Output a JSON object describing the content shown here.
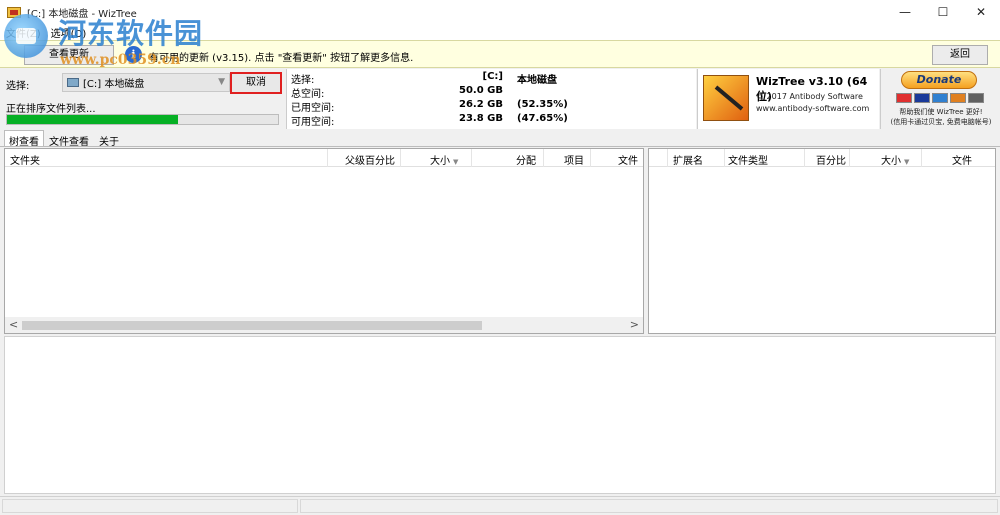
{
  "window": {
    "title": "[C:] 本地磁盘  - WizTree",
    "minimize": "—",
    "maximize": "☐",
    "close": "✕"
  },
  "menu": [
    "文件(Z)",
    "选项(O)"
  ],
  "watermark": {
    "text": "河东软件园",
    "url": "www.pc0359.cn"
  },
  "notification": {
    "update_button": "查看更新",
    "message": "有可用的更新 (v3.15). 点击 \"查看更新\" 按钮了解更多信息.",
    "return_button": "返回"
  },
  "scan": {
    "select_label": "选择:",
    "drive": "[C:] 本地磁盘",
    "cancel_label": "取消",
    "status": "正在排序文件列表...",
    "progress": 0.63
  },
  "drive_stats": {
    "rows": [
      {
        "label": "选择:",
        "value": "[C:]",
        "extra": "本地磁盘"
      },
      {
        "label": "总空间:",
        "value": "50.0 GB",
        "extra": ""
      },
      {
        "label": "已用空间:",
        "value": "26.2 GB",
        "extra": "(52.35%)"
      },
      {
        "label": "可用空间:",
        "value": "23.8 GB",
        "extra": "(47.65%)"
      }
    ]
  },
  "about": {
    "title": "WizTree v3.10 (64 位)",
    "copyright": "© 2017 Antibody Software",
    "website": "www.antibody-software.com"
  },
  "donate": {
    "button": "Donate",
    "line1": "帮助我们使 WizTree 更好!",
    "line2": "(信用卡通过贝宝, 免费电脑帐号)",
    "card_colors": [
      "#e03030",
      "#1a3a9a",
      "#3080d0",
      "#e08020",
      "#606060"
    ]
  },
  "tabs": [
    "树查看",
    "文件查看",
    "关于"
  ],
  "tree_columns": [
    "文件夹",
    "父级百分比",
    "大小",
    "分配",
    "项目",
    "文件"
  ],
  "ext_columns": [
    "扩展名",
    "文件类型",
    "百分比",
    "大小",
    "文件"
  ],
  "scroll_left": "<",
  "scroll_right": ">"
}
